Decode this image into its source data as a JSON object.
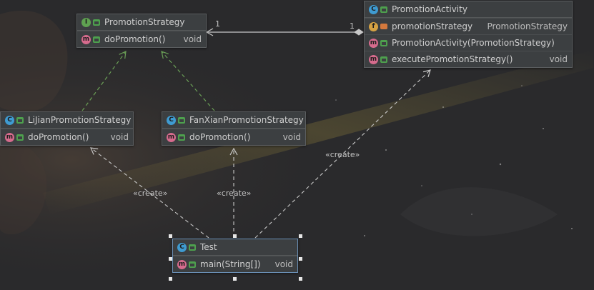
{
  "diagram": {
    "classes": [
      {
        "id": "promotion-strategy",
        "kind": "I",
        "title": "PromotionStrategy",
        "members": [
          {
            "kind": "m",
            "vis": "pub",
            "name": "doPromotion()",
            "type": "void"
          }
        ]
      },
      {
        "id": "promotion-activity",
        "kind": "C",
        "title": "PromotionActivity",
        "members": [
          {
            "kind": "f",
            "vis": "priv",
            "name": "promotionStrategy",
            "type": "PromotionStrategy"
          },
          {
            "kind": "m",
            "vis": "pub",
            "name": "PromotionActivity(PromotionStrategy)",
            "type": ""
          },
          {
            "kind": "m",
            "vis": "pub",
            "name": "executePromotionStrategy()",
            "type": "void"
          }
        ]
      },
      {
        "id": "lijian-promotion-strategy",
        "kind": "C",
        "title": "LiJianPromotionStrategy",
        "members": [
          {
            "kind": "m",
            "vis": "pub",
            "name": "doPromotion()",
            "type": "void"
          }
        ]
      },
      {
        "id": "fanxian-promotion-strategy",
        "kind": "C",
        "title": "FanXianPromotionStrategy",
        "members": [
          {
            "kind": "m",
            "vis": "pub",
            "name": "doPromotion()",
            "type": "void"
          }
        ]
      },
      {
        "id": "test",
        "kind": "C",
        "title": "Test",
        "selected": true,
        "members": [
          {
            "kind": "m",
            "vis": "pub",
            "name": "main(String[])",
            "type": "void"
          }
        ]
      }
    ],
    "relations": [
      {
        "type": "realization",
        "from": "lijian-promotion-strategy",
        "to": "promotion-strategy"
      },
      {
        "type": "realization",
        "from": "fanxian-promotion-strategy",
        "to": "promotion-strategy"
      },
      {
        "type": "aggregation",
        "from": "promotion-activity",
        "to": "promotion-strategy",
        "label_from": "1",
        "label_to": "1"
      },
      {
        "type": "dependency",
        "from": "test",
        "to": "lijian-promotion-strategy",
        "label": "«create»"
      },
      {
        "type": "dependency",
        "from": "test",
        "to": "fanxian-promotion-strategy",
        "label": "«create»"
      },
      {
        "type": "dependency",
        "from": "test",
        "to": "promotion-activity",
        "label": "«create»"
      }
    ],
    "colors": {
      "realization": "#6a9e56",
      "aggregation": "#c8c8c8",
      "dependency": "#c8c8c8",
      "class_background": "#3c3f41",
      "canvas_background": "#2a2a2c"
    }
  }
}
